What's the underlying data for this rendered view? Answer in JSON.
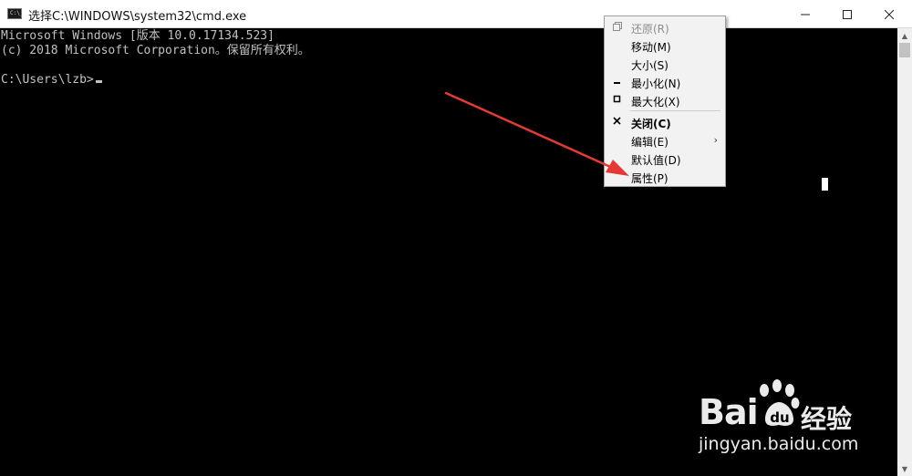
{
  "window": {
    "title": "选择C:\\WINDOWS\\system32\\cmd.exe",
    "icon": "cmd-icon",
    "icon_text": "C:\\_"
  },
  "console": {
    "lines": [
      "Microsoft Windows [版本 10.0.17134.523]",
      "(c) 2018 Microsoft Corporation。保留所有权利。",
      "",
      "C:\\Users\\lzb>"
    ],
    "bg_color": "#000000",
    "text_color": "#c0c0c0"
  },
  "system_menu": {
    "items": [
      {
        "glyph": "restore-icon",
        "label": "还原(R)",
        "enabled": false
      },
      {
        "glyph": "",
        "label": "移动(M)",
        "enabled": true
      },
      {
        "glyph": "",
        "label": "大小(S)",
        "enabled": true
      },
      {
        "glyph": "minimize-icon",
        "label": "最小化(N)",
        "enabled": true
      },
      {
        "glyph": "maximize-icon",
        "label": "最大化(X)",
        "enabled": true
      },
      {
        "glyph": "close-icon",
        "label": "关闭(C)",
        "enabled": true,
        "bold": true
      },
      {
        "glyph": "",
        "label": "编辑(E)",
        "enabled": true,
        "submenu": true
      },
      {
        "glyph": "",
        "label": "默认值(D)",
        "enabled": true
      },
      {
        "glyph": "",
        "label": "属性(P)",
        "enabled": true
      }
    ],
    "submenu_arrow": "›"
  },
  "annotation": {
    "arrow_color": "#e53935"
  },
  "watermark": {
    "brand": "Bai",
    "brand_suffix": "经验",
    "url": "jingyan.baidu.com"
  }
}
